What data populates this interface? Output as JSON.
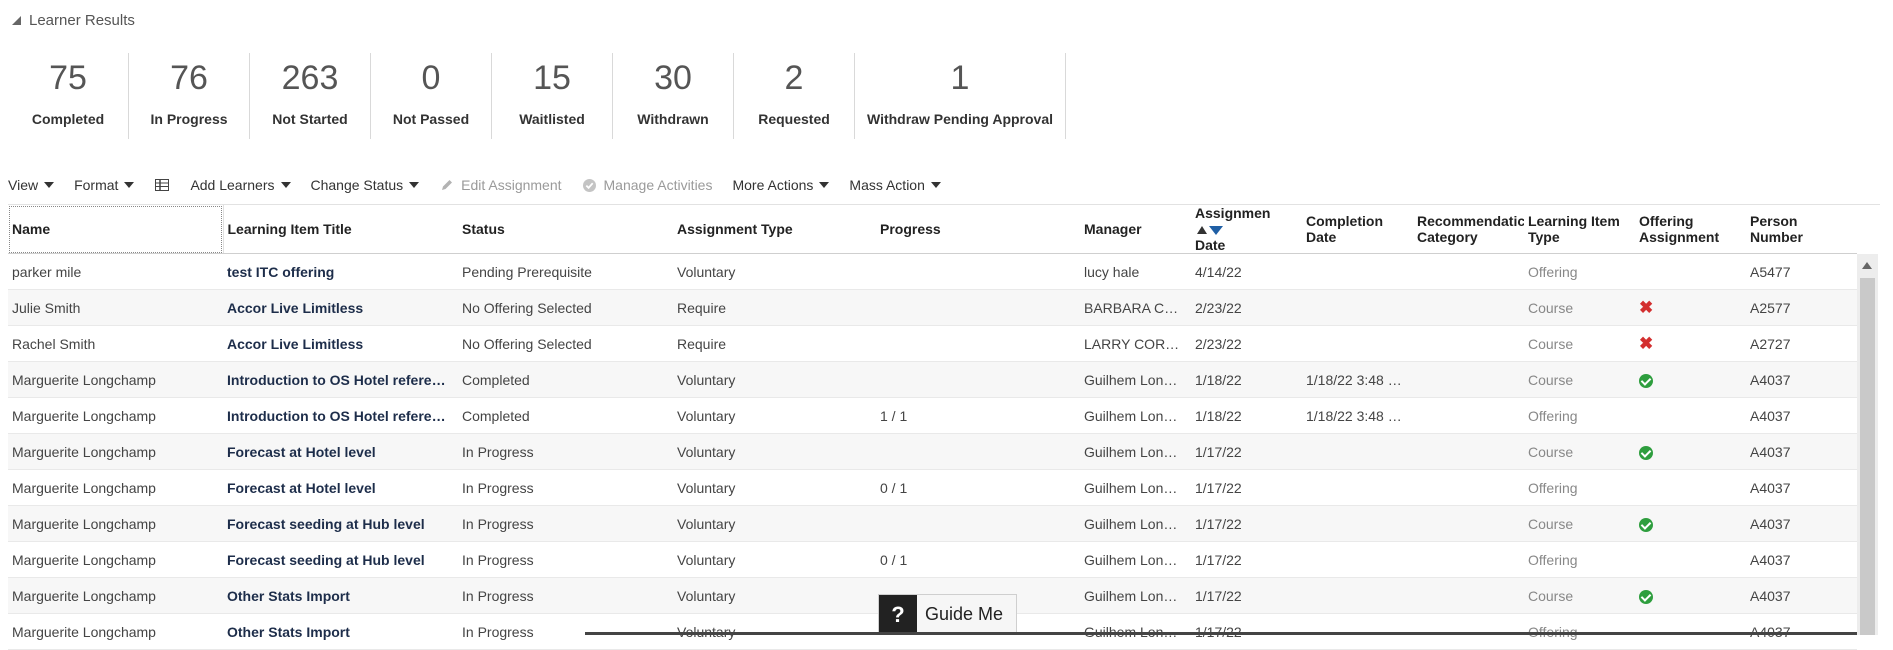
{
  "section": {
    "title": "Learner Results"
  },
  "metrics": [
    {
      "value": "75",
      "label": "Completed"
    },
    {
      "value": "76",
      "label": "In Progress"
    },
    {
      "value": "263",
      "label": "Not Started"
    },
    {
      "value": "0",
      "label": "Not Passed"
    },
    {
      "value": "15",
      "label": "Waitlisted"
    },
    {
      "value": "30",
      "label": "Withdrawn"
    },
    {
      "value": "2",
      "label": "Requested"
    },
    {
      "value": "1",
      "label": "Withdraw Pending Approval"
    }
  ],
  "toolbar": {
    "view": "View",
    "format": "Format",
    "freeze_icon": "freeze-columns-icon",
    "add_learners": "Add Learners",
    "change_status": "Change Status",
    "edit_assignment": "Edit Assignment",
    "manage_activities": "Manage Activities",
    "more_actions": "More Actions",
    "mass_action": "Mass Action"
  },
  "columns": [
    "Name",
    "Learning Item Title",
    "Status",
    "Assignment Type",
    "Progress",
    "Manager",
    "Assignment Date",
    "Completion Date",
    "Recommendation Category",
    "Learning Item Type",
    "Offering Assignment",
    "Person Number"
  ],
  "column_display": {
    "assignment_date": [
      "Assignmen",
      "Date"
    ],
    "completion_date": [
      "Completion",
      "Date"
    ],
    "recommendation_category": [
      "Recommendatic",
      "Category"
    ],
    "learning_item_type": [
      "Learning Item",
      "Type"
    ],
    "offering_assignment": [
      "Offering",
      "Assignment"
    ],
    "person_number": [
      "Person",
      "Number"
    ]
  },
  "rows": [
    {
      "name": "parker mile",
      "title": "test ITC offering",
      "status": "Pending Prerequisite",
      "type": "Voluntary",
      "progress": "",
      "manager": "lucy hale",
      "assign_date": "4/14/22",
      "complete_date": "",
      "rec": "",
      "item_type": "Offering",
      "offering": "",
      "person": "A5477"
    },
    {
      "name": "Julie Smith",
      "title": "Accor Live Limitless",
      "status": "No Offering Selected",
      "type": "Require",
      "progress": "",
      "manager": "BARBARA C…",
      "assign_date": "2/23/22",
      "complete_date": "",
      "rec": "",
      "item_type": "Course",
      "offering": "x",
      "person": "A2577"
    },
    {
      "name": "Rachel Smith",
      "title": "Accor Live Limitless",
      "status": "No Offering Selected",
      "type": "Require",
      "progress": "",
      "manager": "LARRY COR…",
      "assign_date": "2/23/22",
      "complete_date": "",
      "rec": "",
      "item_type": "Course",
      "offering": "x",
      "person": "A2727"
    },
    {
      "name": "Marguerite Longchamp",
      "title": "Introduction to OS Hotel referen…",
      "status": "Completed",
      "type": "Voluntary",
      "progress": "",
      "manager": "Guilhem Lon…",
      "assign_date": "1/18/22",
      "complete_date": "1/18/22 3:48 …",
      "rec": "",
      "item_type": "Course",
      "offering": "check",
      "person": "A4037"
    },
    {
      "name": "Marguerite Longchamp",
      "title": "Introduction to OS Hotel referen…",
      "status": "Completed",
      "type": "Voluntary",
      "progress": "1 / 1",
      "manager": "Guilhem Lon…",
      "assign_date": "1/18/22",
      "complete_date": "1/18/22 3:48 …",
      "rec": "",
      "item_type": "Offering",
      "offering": "",
      "person": "A4037"
    },
    {
      "name": "Marguerite Longchamp",
      "title": "Forecast at Hotel level",
      "status": "In Progress",
      "type": "Voluntary",
      "progress": "",
      "manager": "Guilhem Lon…",
      "assign_date": "1/17/22",
      "complete_date": "",
      "rec": "",
      "item_type": "Course",
      "offering": "check",
      "person": "A4037"
    },
    {
      "name": "Marguerite Longchamp",
      "title": "Forecast at Hotel level",
      "status": "In Progress",
      "type": "Voluntary",
      "progress": "0 / 1",
      "manager": "Guilhem Lon…",
      "assign_date": "1/17/22",
      "complete_date": "",
      "rec": "",
      "item_type": "Offering",
      "offering": "",
      "person": "A4037"
    },
    {
      "name": "Marguerite Longchamp",
      "title": "Forecast seeding at Hub level",
      "status": "In Progress",
      "type": "Voluntary",
      "progress": "",
      "manager": "Guilhem Lon…",
      "assign_date": "1/17/22",
      "complete_date": "",
      "rec": "",
      "item_type": "Course",
      "offering": "check",
      "person": "A4037"
    },
    {
      "name": "Marguerite Longchamp",
      "title": "Forecast seeding at Hub level",
      "status": "In Progress",
      "type": "Voluntary",
      "progress": "0 / 1",
      "manager": "Guilhem Lon…",
      "assign_date": "1/17/22",
      "complete_date": "",
      "rec": "",
      "item_type": "Offering",
      "offering": "",
      "person": "A4037"
    },
    {
      "name": "Marguerite Longchamp",
      "title": "Other Stats Import",
      "status": "In Progress",
      "type": "Voluntary",
      "progress": "",
      "manager": "Guilhem Lon…",
      "assign_date": "1/17/22",
      "complete_date": "",
      "rec": "",
      "item_type": "Course",
      "offering": "check",
      "person": "A4037"
    },
    {
      "name": "Marguerite Longchamp",
      "title": "Other Stats Import",
      "status": "In Progress",
      "type": "Voluntary",
      "progress": "",
      "manager": "Guilhem Lon…",
      "assign_date": "1/17/22",
      "complete_date": "",
      "rec": "",
      "item_type": "Offering",
      "offering": "",
      "person": "A4037"
    }
  ],
  "guide": {
    "mark": "?",
    "label": "Guide Me"
  },
  "colors": {
    "error_x": "#d32f2f",
    "success_check": "#2e9e3e",
    "sort_active": "#1f5fa5",
    "link_text": "#1d2d4a"
  }
}
